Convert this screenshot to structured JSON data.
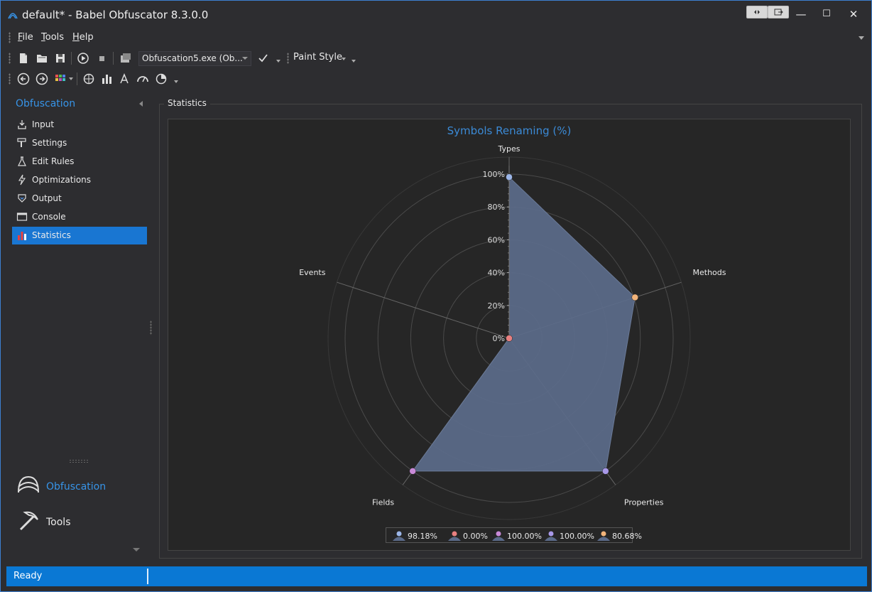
{
  "window": {
    "title": "default* -  Babel Obfuscator 8.3.0.0",
    "controls": {
      "minimize": "—",
      "maximize": "☐",
      "close": "✕"
    }
  },
  "menu": [
    {
      "label": "File",
      "accel": "F",
      "rest": "ile"
    },
    {
      "label": "Tools",
      "accel": "T",
      "rest": "ools"
    },
    {
      "label": "Help",
      "accel": "H",
      "rest": "elp"
    }
  ],
  "toolbar": {
    "target_combo": "Obfuscation5.exe (Ob...",
    "paint_style": "Paint Style"
  },
  "sidebar": {
    "header": "Obfuscation",
    "items": [
      {
        "label": "Input",
        "icon": "input-icon",
        "active": false
      },
      {
        "label": "Settings",
        "icon": "settings-icon",
        "active": false
      },
      {
        "label": "Edit Rules",
        "icon": "flask-icon",
        "active": false
      },
      {
        "label": "Optimizations",
        "icon": "lightning-icon",
        "active": false
      },
      {
        "label": "Output",
        "icon": "output-icon",
        "active": false
      },
      {
        "label": "Console",
        "icon": "console-icon",
        "active": false
      },
      {
        "label": "Statistics",
        "icon": "bar-chart-icon",
        "active": true
      }
    ],
    "big_nav": [
      {
        "label": "Obfuscation",
        "icon": "obfuscation-icon",
        "color": "#3794e8"
      },
      {
        "label": "Tools",
        "icon": "pickaxe-icon",
        "color": "#eaeaea"
      }
    ]
  },
  "content": {
    "group_title": "Statistics"
  },
  "chart_data": {
    "type": "radar",
    "title": "Symbols Renaming (%)",
    "categories": [
      "Types",
      "Methods",
      "Properties",
      "Fields",
      "Events"
    ],
    "values": [
      98.18,
      80.68,
      100.0,
      100.0,
      0.0
    ],
    "axis_ticks": [
      "0%",
      "20%",
      "40%",
      "60%",
      "80%",
      "100%"
    ],
    "ylim": [
      0,
      100
    ],
    "fill_color": "#5b6b8a",
    "point_colors": [
      "#9cb6e8",
      "#f2b47a",
      "#a898e8",
      "#c98ad8",
      "#e88080"
    ],
    "legend": [
      {
        "label": "98.18%",
        "color": "#9cb6e8"
      },
      {
        "label": "0.00%",
        "color": "#e88080"
      },
      {
        "label": "100.00%",
        "color": "#c98ad8"
      },
      {
        "label": "100.00%",
        "color": "#a898e8"
      },
      {
        "label": "80.68%",
        "color": "#f2b47a"
      }
    ]
  },
  "status": {
    "text": "Ready"
  }
}
